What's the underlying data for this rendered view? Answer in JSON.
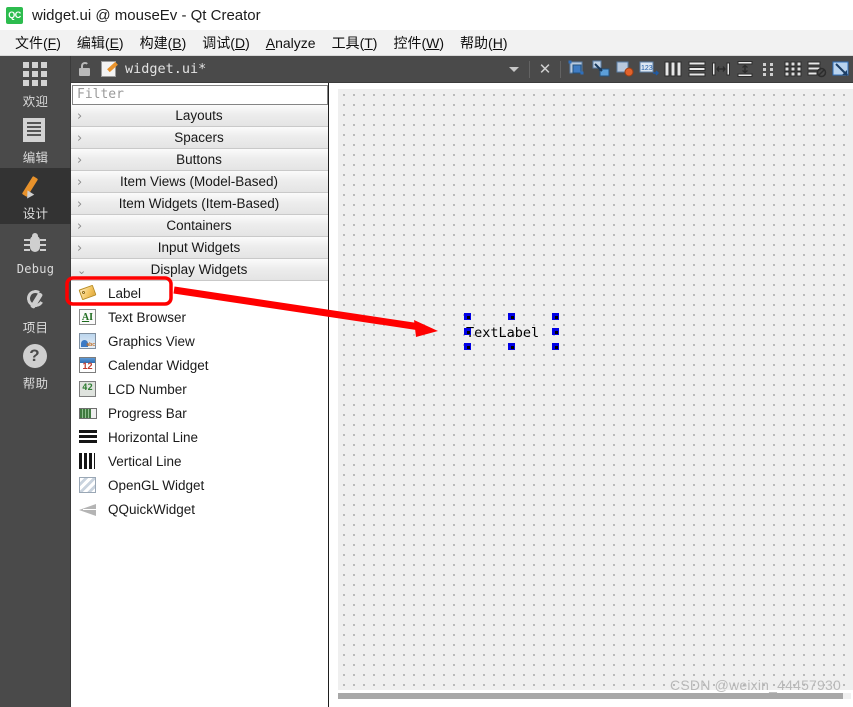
{
  "window": {
    "title": "widget.ui @ mouseEv - Qt Creator",
    "logo_text": "QC",
    "logo_icon": "qt-creator-icon"
  },
  "menubar": {
    "items": [
      {
        "label": "文件",
        "mnemonic": "F"
      },
      {
        "label": "编辑",
        "mnemonic": "E"
      },
      {
        "label": "构建",
        "mnemonic": "B"
      },
      {
        "label": "调试",
        "mnemonic": "D"
      },
      {
        "label": "Analyze",
        "mnemonic": "A",
        "latin": true
      },
      {
        "label": "工具",
        "mnemonic": "T"
      },
      {
        "label": "控件",
        "mnemonic": "W"
      },
      {
        "label": "帮助",
        "mnemonic": "H"
      }
    ]
  },
  "modebar": {
    "items": [
      {
        "label": "欢迎",
        "icon": "grid-icon",
        "active": false
      },
      {
        "label": "编辑",
        "icon": "document-icon",
        "active": false
      },
      {
        "label": "设计",
        "icon": "pencil-icon",
        "active": true
      },
      {
        "label": "Debug",
        "icon": "bug-icon",
        "active": false
      },
      {
        "label": "项目",
        "icon": "wrench-icon",
        "active": false
      },
      {
        "label": "帮助",
        "icon": "question-circle-icon",
        "active": false
      }
    ]
  },
  "editor_toolbar": {
    "lock_icon": "unlocked-icon",
    "file_icon": "ui-file-icon",
    "file_name": "widget.ui*",
    "dropdown_icon": "chevron-down-icon",
    "close_icon": "close-icon",
    "tools": [
      {
        "name": "edit-widgets-icon",
        "tooltip": "Edit Widgets"
      },
      {
        "name": "edit-signals-slots-icon",
        "tooltip": "Edit Signals/Slots"
      },
      {
        "name": "edit-buddies-icon",
        "tooltip": "Edit Buddies"
      },
      {
        "name": "edit-tab-order-icon",
        "tooltip": "Edit Tab Order"
      },
      {
        "name": "layout-horizontally-icon",
        "tooltip": "Lay Out Horizontally"
      },
      {
        "name": "layout-vertically-icon",
        "tooltip": "Lay Out Vertically"
      },
      {
        "name": "layout-splitter-horizontal-icon",
        "tooltip": "Lay Out Horizontally in Splitter"
      },
      {
        "name": "layout-splitter-vertical-icon",
        "tooltip": "Lay Out Vertically in Splitter"
      },
      {
        "name": "layout-form-icon",
        "tooltip": "Lay Out in a Form Layout"
      },
      {
        "name": "layout-grid-icon",
        "tooltip": "Lay Out in a Grid"
      },
      {
        "name": "break-layout-icon",
        "tooltip": "Break Layout"
      },
      {
        "name": "adjust-size-icon",
        "tooltip": "Adjust Size"
      }
    ]
  },
  "widgetbox": {
    "filter_placeholder": "Filter",
    "filter_value": "",
    "categories": [
      {
        "label": "Layouts",
        "expanded": false
      },
      {
        "label": "Spacers",
        "expanded": false
      },
      {
        "label": "Buttons",
        "expanded": false
      },
      {
        "label": "Item Views (Model-Based)",
        "expanded": false
      },
      {
        "label": "Item Widgets (Item-Based)",
        "expanded": false
      },
      {
        "label": "Containers",
        "expanded": false
      },
      {
        "label": "Input Widgets",
        "expanded": false
      },
      {
        "label": "Display Widgets",
        "expanded": true
      }
    ],
    "display_widgets": [
      {
        "label": "Label",
        "icon": "label-tag-icon",
        "highlighted": true
      },
      {
        "label": "Text Browser",
        "icon": "text-browser-icon",
        "highlighted": false
      },
      {
        "label": "Graphics View",
        "icon": "graphics-view-icon",
        "highlighted": false
      },
      {
        "label": "Calendar Widget",
        "icon": "calendar-icon",
        "highlighted": false
      },
      {
        "label": "LCD Number",
        "icon": "lcd-number-icon",
        "highlighted": false
      },
      {
        "label": "Progress Bar",
        "icon": "progress-bar-icon",
        "highlighted": false
      },
      {
        "label": "Horizontal Line",
        "icon": "horizontal-line-icon",
        "highlighted": false
      },
      {
        "label": "Vertical Line",
        "icon": "vertical-line-icon",
        "highlighted": false
      },
      {
        "label": "OpenGL Widget",
        "icon": "opengl-widget-icon",
        "highlighted": false
      },
      {
        "label": "QQuickWidget",
        "icon": "qquickwidget-icon",
        "highlighted": false
      }
    ],
    "calendar_icon_number": "12",
    "lcd_icon_number": "42",
    "text_browser_icon_glyph": "AI"
  },
  "canvas": {
    "selected_widget_text": "TextLabel",
    "selected_widget_type": "QLabel",
    "handle_count": 8,
    "grid": "dots"
  },
  "annotation": {
    "highlight_color": "#ff0000",
    "arrow_from": "Label widget in Display Widgets",
    "arrow_to": "TextLabel on form canvas"
  },
  "watermark": {
    "text": "CSDN @weixin_44457930"
  },
  "colors": {
    "accent_orange": "#e8922b",
    "mode_bar_bg": "#4a4a4a",
    "mode_active_bg": "#333333",
    "canvas_bg": "#efefef",
    "selection_handle": "#0000e6",
    "annotation_red": "#ff0000",
    "qt_green": "#2dbc4e"
  }
}
